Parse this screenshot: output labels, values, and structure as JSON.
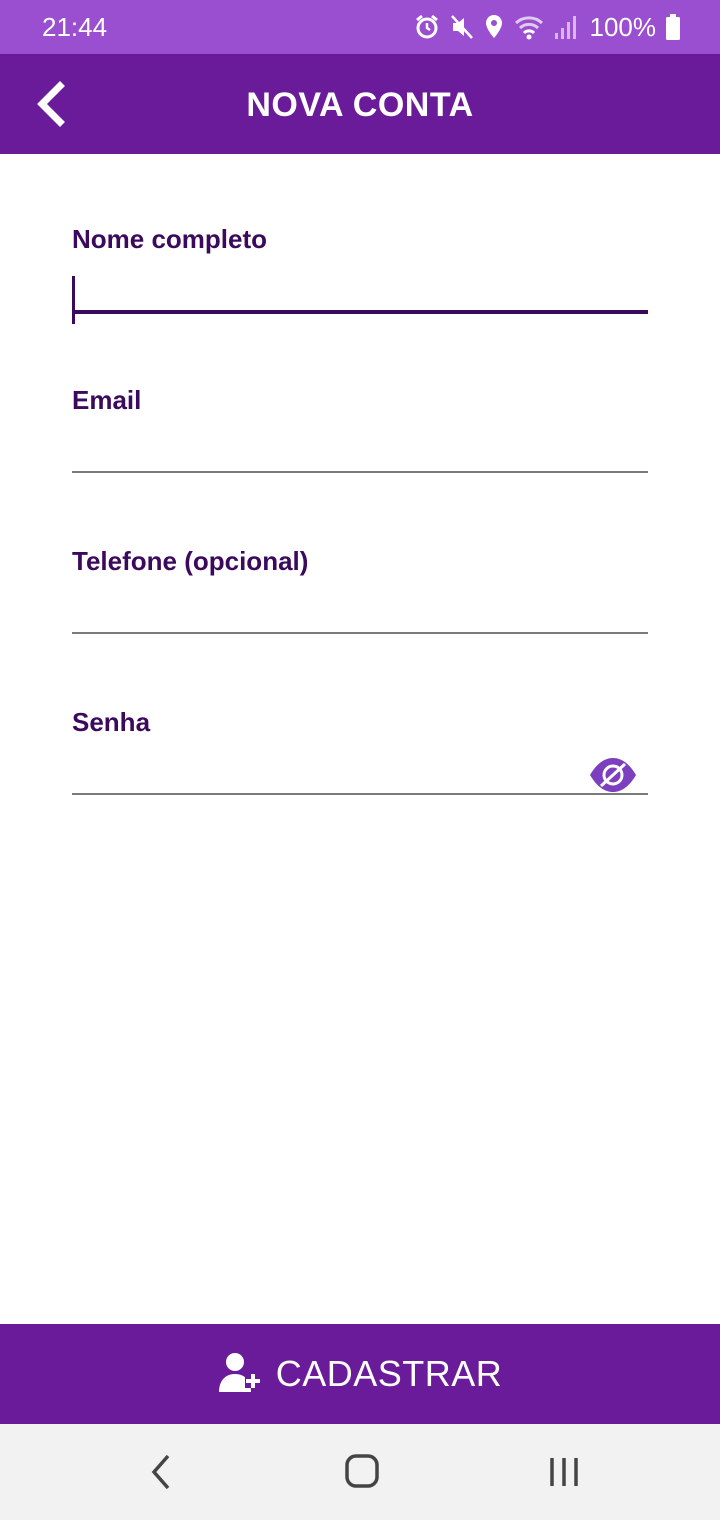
{
  "status_bar": {
    "time": "21:44",
    "battery": "100%",
    "icons": [
      "alarm-icon",
      "mute-icon",
      "location-icon",
      "wifi-icon",
      "signal-icon",
      "battery-icon"
    ]
  },
  "app_bar": {
    "title": "NOVA CONTA",
    "back_icon": "chevron-left-icon"
  },
  "form": {
    "name_label": "Nome completo",
    "name_value": "",
    "email_label": "Email",
    "email_value": "",
    "phone_label": "Telefone (opcional)",
    "phone_value": "",
    "password_label": "Senha",
    "password_value": "",
    "password_toggle_icon": "eye-slash-icon"
  },
  "submit": {
    "label": "CADASTRAR",
    "icon": "user-add-icon"
  },
  "nav_bar": {
    "back_icon": "nav-back-icon",
    "home_icon": "nav-home-icon",
    "recents_icon": "nav-recents-icon"
  },
  "colors": {
    "status_bar": "#9a4fd0",
    "primary": "#6a1b9a",
    "label": "#3b0a5c",
    "accent_icon": "#7b3fbf",
    "nav_bar": "#f2f2f2"
  }
}
